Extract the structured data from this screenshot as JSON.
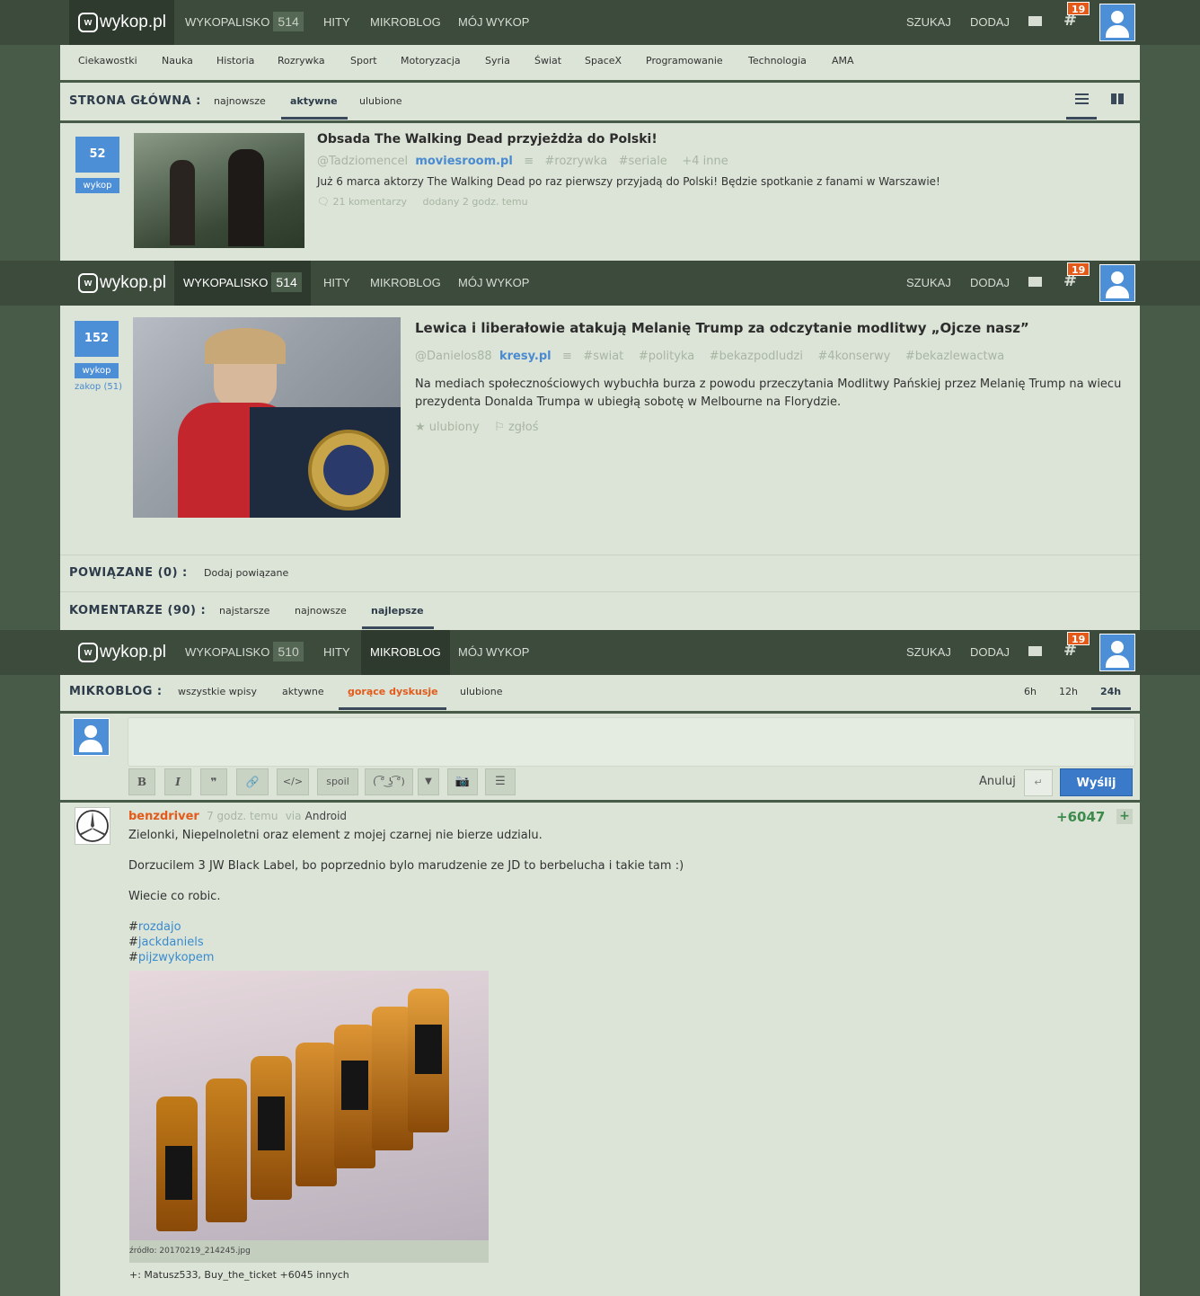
{
  "nav": {
    "logo": "wykop.pl",
    "items": [
      "WYKOPALISKO",
      "HITY",
      "MIKROBLOG",
      "MÓJ WYKOP"
    ],
    "counts": [
      "514",
      "514",
      "510"
    ],
    "search": "SZUKAJ",
    "add": "DODAJ",
    "notif_badge": "19"
  },
  "categories": [
    "Ciekawostki",
    "Nauka",
    "Historia",
    "Rozrywka",
    "Sport",
    "Motoryzacja",
    "Syria",
    "Świat",
    "SpaceX",
    "Programowanie",
    "Technologia",
    "AMA"
  ],
  "home": {
    "label": "STRONA GŁÓWNA :",
    "tabs": [
      "najnowsze",
      "aktywne",
      "ulubione"
    ]
  },
  "link1": {
    "votes": "52",
    "wykop_label": "wykop",
    "title": "Obsada The Walking Dead przyjeżdża do Polski!",
    "author": "@Tadziomencel",
    "domain": "moviesroom.pl",
    "tags": [
      "#rozrywka",
      "#seriale",
      "+4 inne"
    ],
    "description": "Już 6 marca aktorzy The Walking Dead po raz pierwszy przyjadą do Polski! Będzie spotkanie z fanami w Warszawie!",
    "comments": "21 komentarzy",
    "added": "dodany 2 godz. temu"
  },
  "link2": {
    "votes": "152",
    "wykop_label": "wykop",
    "bury": "zakop (51)",
    "title": "Lewica i liberałowie atakują Melanię Trump za odczytanie modlitwy „Ojcze nasz”",
    "author": "@Danielos88",
    "domain": "kresy.pl",
    "tags": [
      "#swiat",
      "#polityka",
      "#bekazpodludzi",
      "#4konserwy",
      "#bekazlewactwa"
    ],
    "description": "Na mediach społecznościowych wybuchła burza z powodu przeczytania Modlitwy Pańskiej przez Melanię Trump na wiecu prezydenta Donalda Trumpa w ubiegłą sobotę w Melbourne na Florydzie.",
    "favorite": "ulubiony",
    "report": "zgłoś"
  },
  "related": {
    "label": "POWIĄZANE (0) :",
    "add": "Dodaj powiązane"
  },
  "comments": {
    "label": "KOMENTARZE (90) :",
    "tabs": [
      "najstarsze",
      "najnowsze",
      "najlepsze"
    ]
  },
  "mikroblog": {
    "label": "MIKROBLOG :",
    "tabs": [
      "wszystkie wpisy",
      "aktywne",
      "gorące dyskusje",
      "ulubione"
    ],
    "periods": [
      "6h",
      "12h",
      "24h"
    ]
  },
  "editor": {
    "tools": [
      "B",
      "I",
      "❞",
      "🔗",
      "</>",
      "spoil",
      "( ͡° ͜ʖ ͡°)",
      "▼",
      "📷",
      "☰"
    ],
    "cancel": "Anuluj",
    "enter": "↵",
    "send": "Wyślij"
  },
  "post": {
    "author": "benzdriver",
    "time": "7 godz. temu",
    "via": "via",
    "client": "Android",
    "score": "+6047",
    "plus": "+",
    "lines": [
      "Zielonki, Niepelnoletni oraz element z mojej czarnej nie bierze udzialu.",
      "Dorzucilem 3 JW Black Label, bo poprzednio bylo marudzenie ze JD to berbelucha i takie tam :)",
      "Wiecie co robic."
    ],
    "tags": [
      "rozdajo",
      "jackdaniels",
      "pijzwykopem"
    ],
    "image_source": "źródło: 20170219_214245.jpg",
    "voters": "+: Matusz533, Buy_the_ticket +6045 innych"
  },
  "colors": {
    "nav_bg": "#3c4b3c",
    "panel_bg": "#dbe4d6",
    "accent_blue": "#4d8fd6",
    "author_orange": "#e35a1a",
    "score_green": "#3d8a4d"
  }
}
